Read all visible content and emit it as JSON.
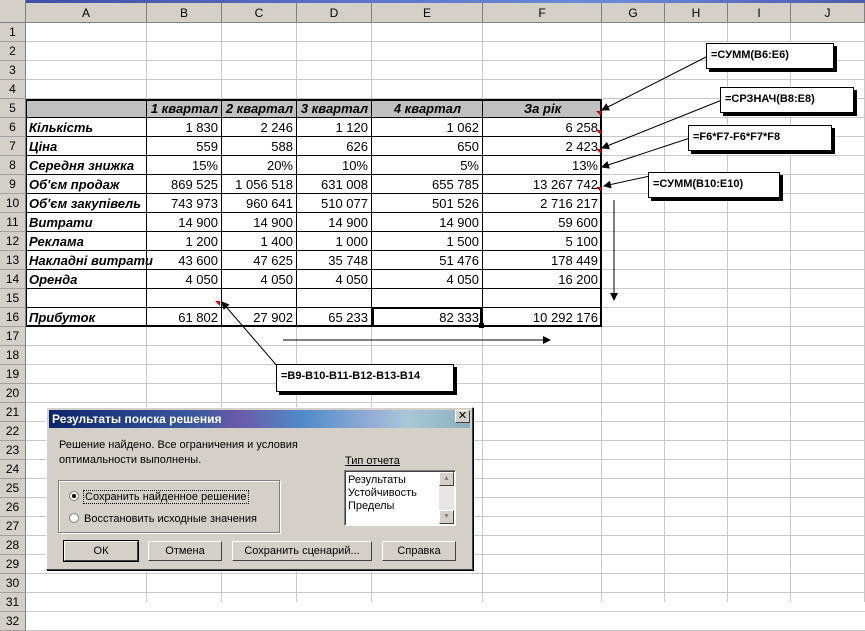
{
  "sheet": {
    "columns": [
      "A",
      "B",
      "C",
      "D",
      "E",
      "F",
      "G",
      "H",
      "I",
      "J"
    ],
    "rows": [
      "1",
      "2",
      "3",
      "4",
      "5",
      "6",
      "7",
      "8",
      "9",
      "10",
      "11",
      "12",
      "13",
      "14",
      "15",
      "16",
      "17",
      "18",
      "19",
      "20",
      "21",
      "22",
      "23",
      "24",
      "25",
      "26",
      "27",
      "28",
      "29",
      "30",
      "31",
      "32"
    ],
    "headers": [
      "1 квартал",
      "2 квартал",
      "3 квартал",
      "4 квартал",
      "За рік"
    ],
    "data_rows": [
      {
        "row": 6,
        "label": "Кількість",
        "values": [
          "1 830",
          "2 246",
          "1 120",
          "1 062",
          "6 258"
        ]
      },
      {
        "row": 7,
        "label": "Ціна",
        "values": [
          "559",
          "588",
          "626",
          "650",
          "2 423"
        ]
      },
      {
        "row": 8,
        "label": "Середня знижка",
        "values": [
          "15%",
          "20%",
          "10%",
          "5%",
          "13%"
        ]
      },
      {
        "row": 9,
        "label": "Об'єм продаж",
        "values": [
          "869 525",
          "1 056 518",
          "631 008",
          "655 785",
          "13 267 742"
        ]
      },
      {
        "row": 10,
        "label": "Об'єм закупівель",
        "values": [
          "743 973",
          "960 641",
          "510 077",
          "501 526",
          "2 716 217"
        ]
      },
      {
        "row": 11,
        "label": "Витрати",
        "values": [
          "14 900",
          "14 900",
          "14 900",
          "14 900",
          "59 600"
        ]
      },
      {
        "row": 12,
        "label": "Реклама",
        "values": [
          "1 200",
          "1 400",
          "1 000",
          "1 500",
          "5 100"
        ]
      },
      {
        "row": 13,
        "label": "Накладні витрати",
        "values": [
          "43 600",
          "47 625",
          "35 748",
          "51 476",
          "178 449"
        ]
      },
      {
        "row": 14,
        "label": "Оренда",
        "values": [
          "4 050",
          "4 050",
          "4 050",
          "4 050",
          "16 200"
        ]
      },
      {
        "row": 16,
        "label": "Прибуток",
        "values": [
          "61 802",
          "27 902",
          "65 233",
          "82 333",
          "10 292 176"
        ]
      }
    ]
  },
  "callouts": {
    "sum_sales": "=СУММ(B6:E6)",
    "avg_price": "=СРЗНАЧ(B8:E8)",
    "sales_formula": "=F6*F7-F6*F7*F8",
    "sum_purchases": "=СУММ(B10:E10)",
    "profit_formula": "=B9-B10-B11-B12-B13-B14"
  },
  "dialog": {
    "title": "Результаты поиска решения",
    "close": "✕",
    "message": "Решение найдено. Все ограничения и условия оптимальности выполнены.",
    "report_type_label": "Тип отчета",
    "reports": [
      "Результаты",
      "Устойчивость",
      "Пределы"
    ],
    "radio_keep": "Сохранить найденное решение",
    "radio_restore": "Восстановить исходные значения",
    "btn_ok": "ОК",
    "btn_cancel": "Отмена",
    "btn_save_scenario": "Сохранить сценарий...",
    "btn_help": "Справка"
  },
  "icons": {
    "close": "close-icon",
    "scroll_up": "scroll-up-icon",
    "scroll_down": "scroll-down-icon"
  }
}
